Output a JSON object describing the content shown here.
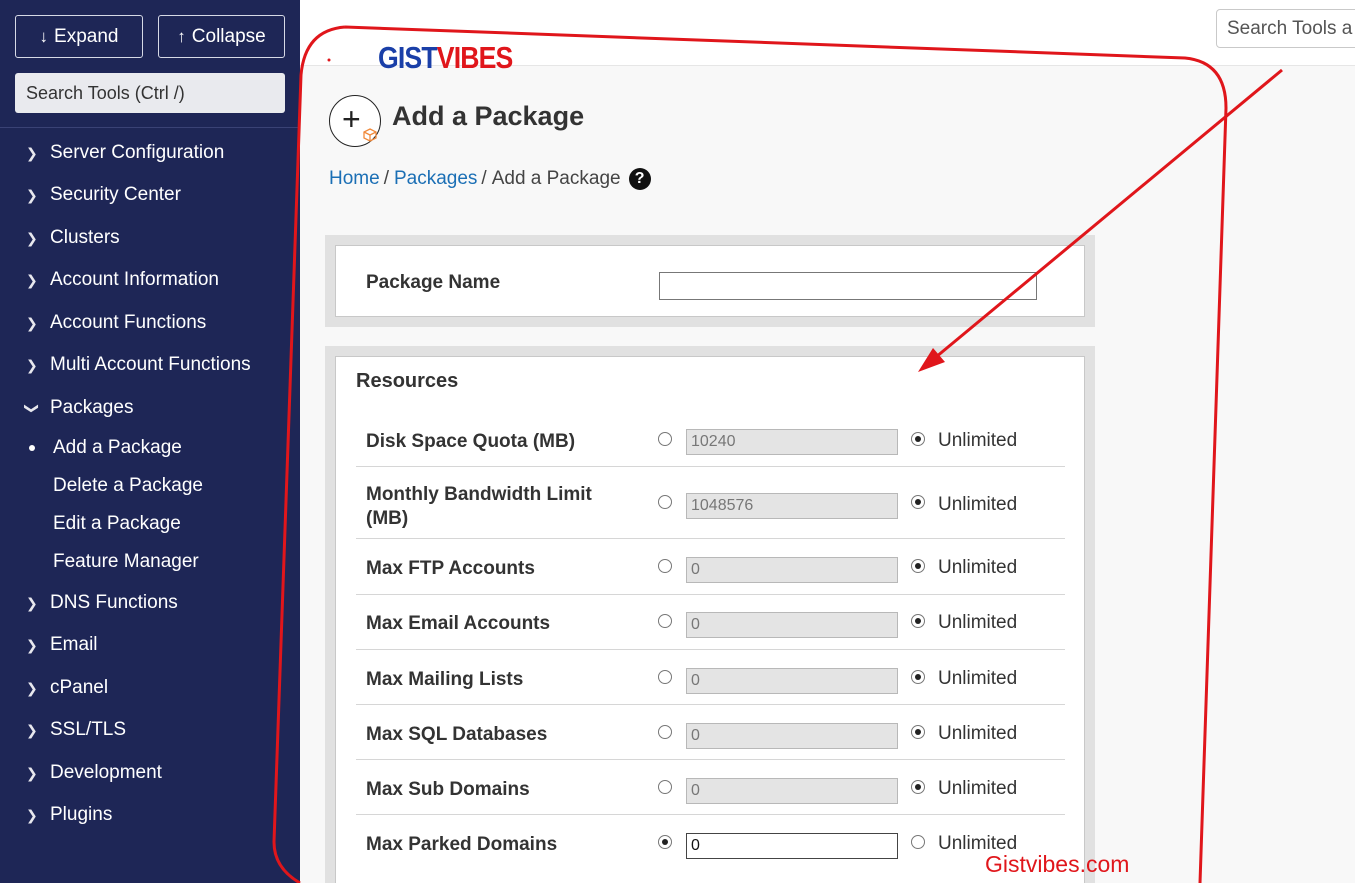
{
  "sidebar": {
    "expand_label": "Expand",
    "collapse_label": "Collapse",
    "search_placeholder": "Search Tools (Ctrl /)",
    "items": [
      {
        "label": "Server Configuration"
      },
      {
        "label": "Security Center"
      },
      {
        "label": "Clusters"
      },
      {
        "label": "Account Information"
      },
      {
        "label": "Account Functions"
      },
      {
        "label": "Multi Account Functions"
      },
      {
        "label": "Packages"
      },
      {
        "label": "DNS Functions"
      },
      {
        "label": "Email"
      },
      {
        "label": "cPanel"
      },
      {
        "label": "SSL/TLS"
      },
      {
        "label": "Development"
      },
      {
        "label": "Plugins"
      }
    ],
    "sub_items": [
      {
        "label": "Add a Package",
        "active": true
      },
      {
        "label": "Delete a Package"
      },
      {
        "label": "Edit a Package"
      },
      {
        "label": "Feature Manager"
      }
    ]
  },
  "top_search_placeholder": "Search Tools a",
  "logo": {
    "part1": "GIST",
    "part2": "VIBES"
  },
  "page": {
    "title": "Add a Package",
    "breadcrumb": {
      "home": "Home",
      "packages": "Packages",
      "current": "Add a Package",
      "separator": "/"
    },
    "help_icon": "?"
  },
  "package_name": {
    "label": "Package Name",
    "value": ""
  },
  "resources": {
    "title": "Resources",
    "unlimited_label": "Unlimited",
    "rows": [
      {
        "label": "Disk Space Quota (MB)",
        "value": "10240",
        "unlimited": true
      },
      {
        "label": "Monthly Bandwidth Limit (MB)",
        "value": "1048576",
        "unlimited": true
      },
      {
        "label": "Max FTP Accounts",
        "value": "0",
        "unlimited": true
      },
      {
        "label": "Max Email Accounts",
        "value": "0",
        "unlimited": true
      },
      {
        "label": "Max Mailing Lists",
        "value": "0",
        "unlimited": true
      },
      {
        "label": "Max SQL Databases",
        "value": "0",
        "unlimited": true
      },
      {
        "label": "Max Sub Domains",
        "value": "0",
        "unlimited": true
      },
      {
        "label": "Max Parked Domains",
        "value": "0",
        "unlimited": false
      }
    ]
  },
  "watermark": "Gistvibes.com",
  "colors": {
    "sidebar_bg": "#1e2656",
    "link": "#1b6fb5",
    "annotation": "#e0161b",
    "logo_blue": "#1a3fa8"
  }
}
